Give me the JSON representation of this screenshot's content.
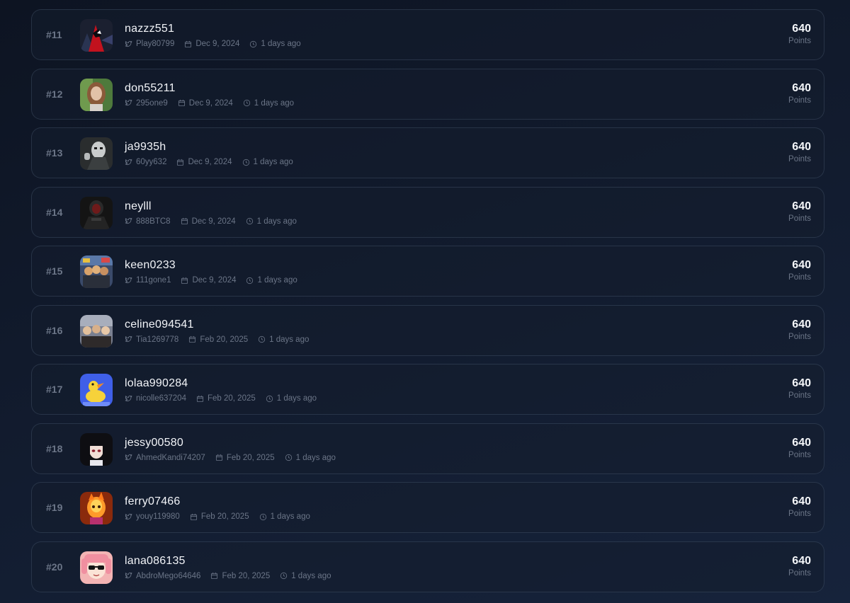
{
  "leaderboard": {
    "rows": [
      {
        "rank": "#11",
        "username": "nazzz551",
        "twitter": "Play80799",
        "date": "Dec 9, 2024",
        "ago": "1 days ago",
        "points": "640",
        "points_label": "Points",
        "avatar": "spider-hero-avatar",
        "avatar_colors": [
          "#1b2030",
          "#c2121e"
        ]
      },
      {
        "rank": "#12",
        "username": "don55211",
        "twitter": "295one9",
        "date": "Dec 9, 2024",
        "ago": "1 days ago",
        "points": "640",
        "points_label": "Points",
        "avatar": "woman-portrait-avatar",
        "avatar_colors": [
          "#4e7a3c",
          "#d9b8a0"
        ]
      },
      {
        "rank": "#13",
        "username": "ja9935h",
        "twitter": "60yy632",
        "date": "Dec 9, 2024",
        "ago": "1 days ago",
        "points": "640",
        "points_label": "Points",
        "avatar": "masked-figure-avatar",
        "avatar_colors": [
          "#2a2d2e",
          "#c9cccc"
        ]
      },
      {
        "rank": "#14",
        "username": "neylll",
        "twitter": "888BTC8",
        "date": "Dec 9, 2024",
        "ago": "1 days ago",
        "points": "640",
        "points_label": "Points",
        "avatar": "hooded-figure-avatar",
        "avatar_colors": [
          "#141414",
          "#6e1a1a"
        ]
      },
      {
        "rank": "#15",
        "username": "keen0233",
        "twitter": "111gone1",
        "date": "Dec 9, 2024",
        "ago": "1 days ago",
        "points": "640",
        "points_label": "Points",
        "avatar": "group-photo-avatar",
        "avatar_colors": [
          "#3a4a6a",
          "#d8a26a"
        ]
      },
      {
        "rank": "#16",
        "username": "celine094541",
        "twitter": "Tia1269778",
        "date": "Feb 20, 2025",
        "ago": "1 days ago",
        "points": "640",
        "points_label": "Points",
        "avatar": "friends-photo-avatar",
        "avatar_colors": [
          "#7a8090",
          "#e2c09c"
        ]
      },
      {
        "rank": "#17",
        "username": "lolaa990284",
        "twitter": "nicolle637204",
        "date": "Feb 20, 2025",
        "ago": "1 days ago",
        "points": "640",
        "points_label": "Points",
        "avatar": "yellow-duck-avatar",
        "avatar_colors": [
          "#3f5fe8",
          "#f6d23a"
        ]
      },
      {
        "rank": "#18",
        "username": "jessy00580",
        "twitter": "AhmedKandi74207",
        "date": "Feb 20, 2025",
        "ago": "1 days ago",
        "points": "640",
        "points_label": "Points",
        "avatar": "anime-girl-avatar",
        "avatar_colors": [
          "#0e0e12",
          "#f1ded6"
        ]
      },
      {
        "rank": "#19",
        "username": "ferry07466",
        "twitter": "youy119980",
        "date": "Feb 20, 2025",
        "ago": "1 days ago",
        "points": "640",
        "points_label": "Points",
        "avatar": "fire-character-avatar",
        "avatar_colors": [
          "#8a2a0c",
          "#ff9a2a"
        ]
      },
      {
        "rank": "#20",
        "username": "lana086135",
        "twitter": "AbdroMego64646",
        "date": "Feb 20, 2025",
        "ago": "1 days ago",
        "points": "640",
        "points_label": "Points",
        "avatar": "pink-hair-sunglasses-avatar",
        "avatar_colors": [
          "#f3b4b4",
          "#fbe3d6"
        ]
      }
    ]
  }
}
